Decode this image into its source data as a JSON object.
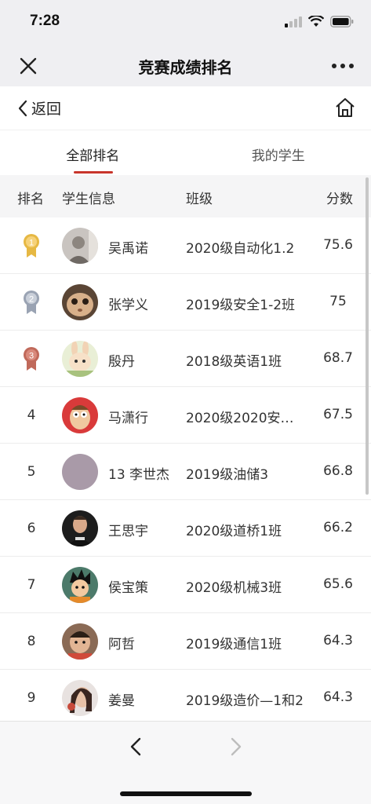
{
  "status": {
    "time": "7:28"
  },
  "header": {
    "title": "竞赛成绩排名"
  },
  "nav": {
    "back_label": "返回"
  },
  "tabs": [
    {
      "label": "全部排名"
    },
    {
      "label": "我的学生"
    }
  ],
  "table": {
    "columns": [
      "排名",
      "学生信息",
      "班级",
      "分数"
    ],
    "rows": [
      {
        "rank": "1",
        "name": "吴禹诺",
        "class": "2020级自动化1.2",
        "score": "75.6",
        "medal": "gold"
      },
      {
        "rank": "2",
        "name": "张学义",
        "class": "2019级安全1-2班",
        "score": "75",
        "medal": "silver"
      },
      {
        "rank": "3",
        "name": "殷丹",
        "class": "2018级英语1班",
        "score": "68.7",
        "medal": "bronze"
      },
      {
        "rank": "4",
        "name": "马潇行",
        "class": "2020级2020安全…",
        "score": "67.5"
      },
      {
        "rank": "5",
        "name": "13 李世杰",
        "class": "2019级油储3",
        "score": "66.8"
      },
      {
        "rank": "6",
        "name": "王思宇",
        "class": "2020级道桥1班",
        "score": "66.2"
      },
      {
        "rank": "7",
        "name": "侯宝策",
        "class": "2020级机械3班",
        "score": "65.6"
      },
      {
        "rank": "8",
        "name": "阿哲",
        "class": "2019级通信1班",
        "score": "64.3"
      },
      {
        "rank": "9",
        "name": "姜曼",
        "class": "2019级造价—1和2",
        "score": "64.3"
      }
    ]
  },
  "colors": {
    "accent": "#c8352b",
    "gold": "#e6b843",
    "silver": "#9aa3b3",
    "bronze": "#c0695a"
  }
}
